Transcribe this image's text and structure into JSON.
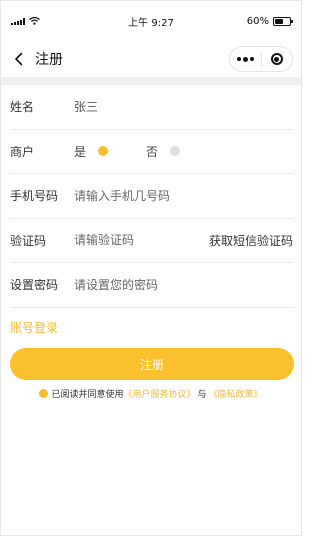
{
  "status_bar": {
    "time": "上午 9:27",
    "battery": "60%",
    "battery_level": 0.6
  },
  "navbar": {
    "title": "注册",
    "icons": [
      "back-arrow-icon",
      "more-dots-icon",
      "close-target-icon"
    ]
  },
  "form": {
    "name": {
      "label": "姓名",
      "value": "张三"
    },
    "merchant": {
      "label": "商户",
      "options": [
        {
          "label": "是",
          "selected": true
        },
        {
          "label": "否",
          "selected": false
        }
      ]
    },
    "phone": {
      "label": "手机号码",
      "placeholder": "请输入手机几号码"
    },
    "code": {
      "label": "验证码",
      "placeholder": "请输验证码",
      "sms_button": "获取短信验证码"
    },
    "password": {
      "label": "设置密码",
      "placeholder": "请设置您的密码"
    }
  },
  "account_login": "账号登录",
  "submit_label": "注册",
  "agreement": {
    "prefix": "已阅读并同意使用",
    "user_agreement": "《用户服务协议》",
    "connector": "与",
    "privacy_policy": "《隐私政策》"
  },
  "colors": {
    "accent": "#fbc02d",
    "link": "#f0b93a",
    "radio_off": "#dddddd"
  }
}
